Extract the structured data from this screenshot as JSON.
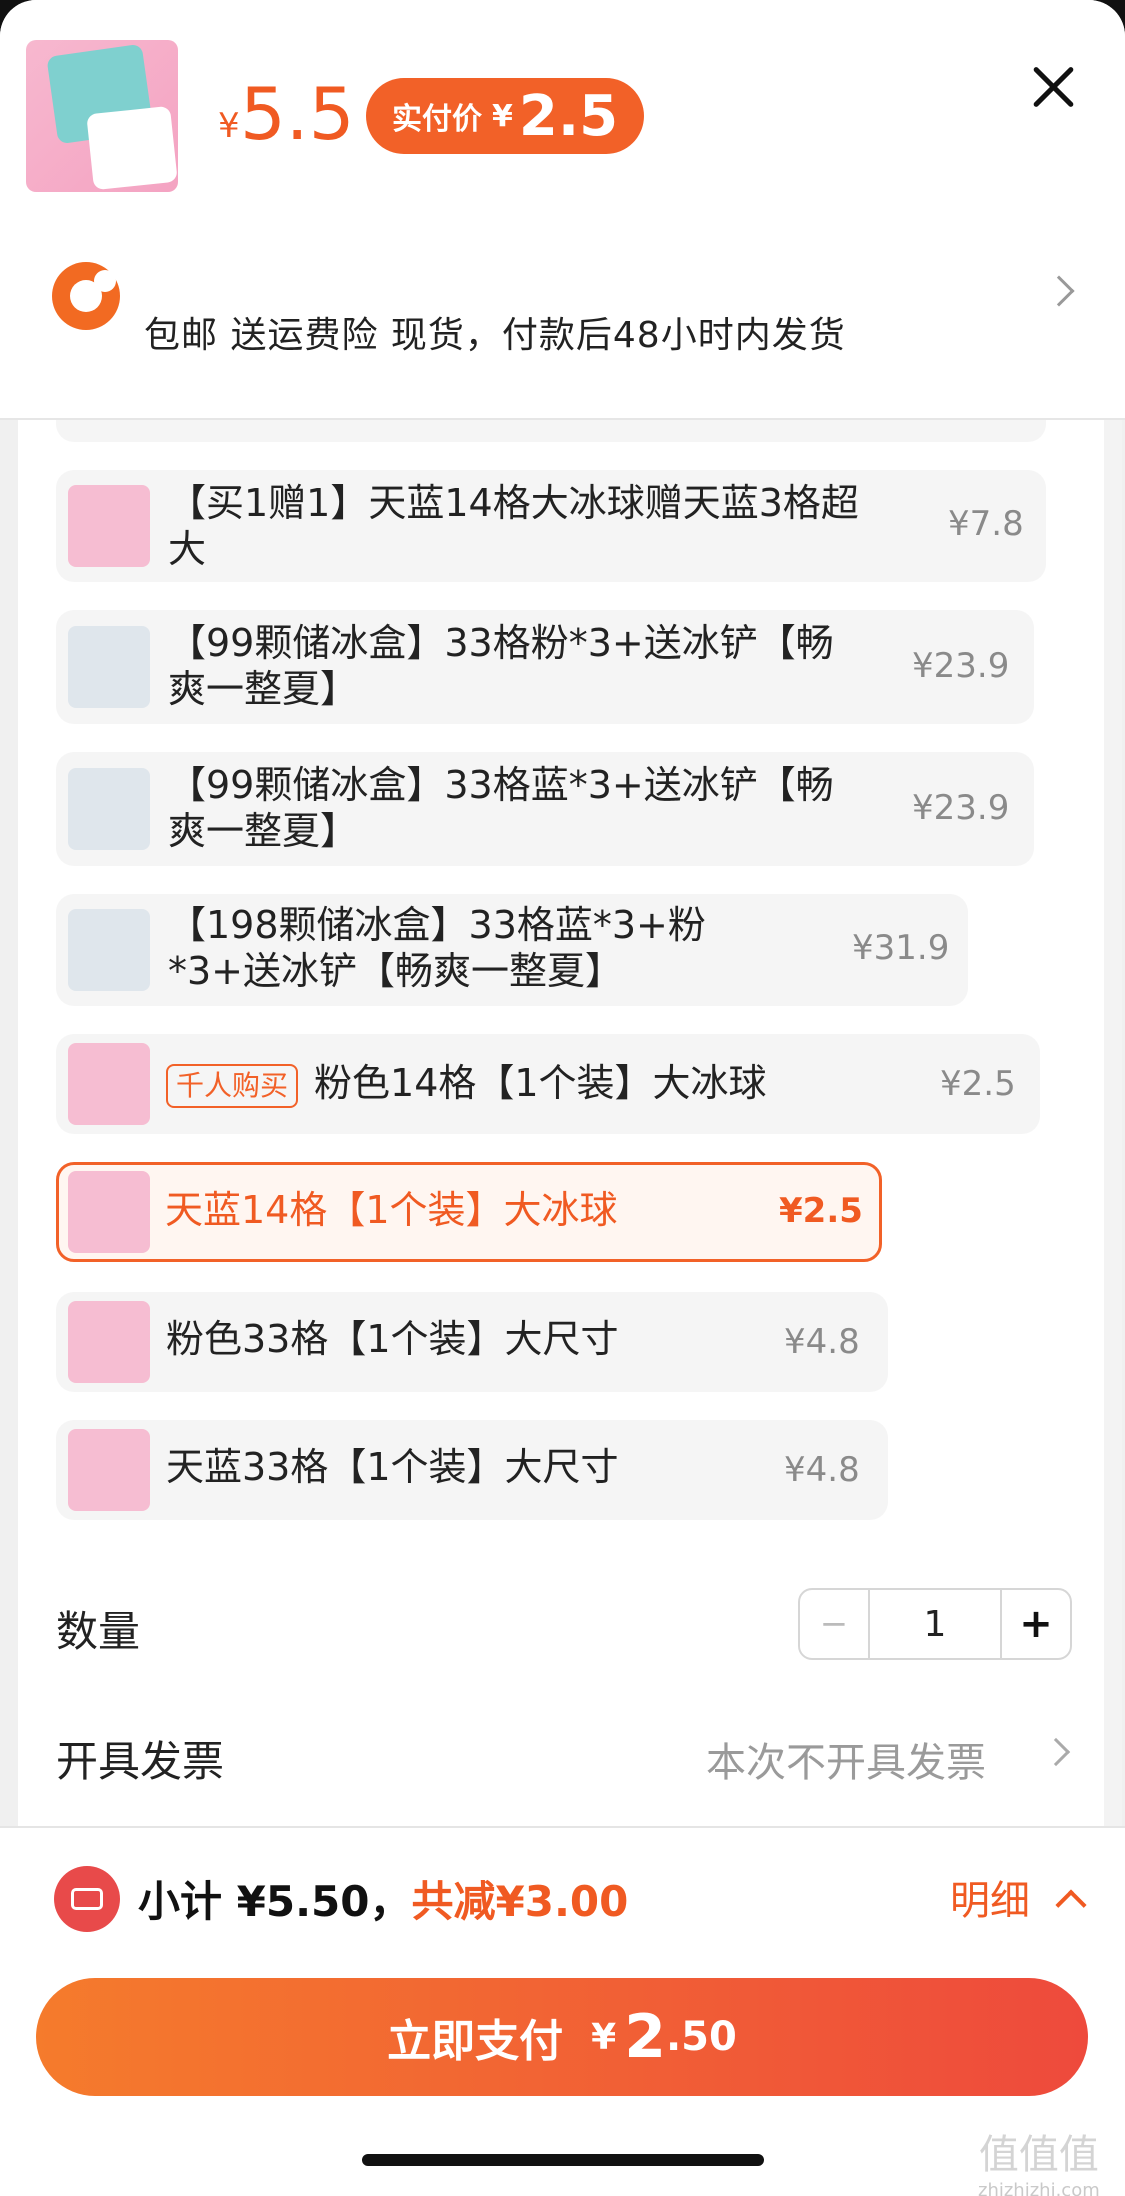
{
  "header": {
    "price_currency": "¥",
    "price": "5.5",
    "pay_label": "实付价",
    "pay_currency": "¥",
    "pay_amount": "2.5",
    "shipping": "包邮  送运费险  现货，付款后48小时内发货"
  },
  "options": [
    {
      "title": "【买1赠1】天蓝14格大冰球赠天蓝3格超大",
      "price": "¥7.8",
      "thumb_color": "#f6bdd2",
      "selected": false
    },
    {
      "title": "【99颗储冰盒】33格粉*3+送冰铲【畅爽一整夏】",
      "price": "¥23.9",
      "thumb_color": "#dfe6ec",
      "selected": false
    },
    {
      "title": "【99颗储冰盒】33格蓝*3+送冰铲【畅爽一整夏】",
      "price": "¥23.9",
      "thumb_color": "#dfe6ec",
      "selected": false
    },
    {
      "title": "【198颗储冰盒】33格蓝*3+粉*3+送冰铲【畅爽一整夏】",
      "price": "¥31.9",
      "thumb_color": "#dfe6ec",
      "selected": false
    },
    {
      "badge": "千人购买",
      "title": "粉色14格【1个装】大冰球",
      "price": "¥2.5",
      "thumb_color": "#f6bdd2",
      "selected": false
    },
    {
      "title": "天蓝14格【1个装】大冰球",
      "price": "¥2.5",
      "thumb_color": "#f6bdd2",
      "selected": true
    },
    {
      "title": "粉色33格【1个装】大尺寸",
      "price": "¥4.8",
      "thumb_color": "#f6bdd2",
      "selected": false
    },
    {
      "title": "天蓝33格【1个装】大尺寸",
      "price": "¥4.8",
      "thumb_color": "#f6bdd2",
      "selected": false
    }
  ],
  "quantity": {
    "label": "数量",
    "minus": "−",
    "value": "1",
    "plus": "+"
  },
  "invoice": {
    "label": "开具发票",
    "value": "本次不开具发票"
  },
  "footer": {
    "subtotal_label": "小计",
    "subtotal": "¥5.50，",
    "discount": "共减¥3.00",
    "detail": "明细",
    "pay_label": "立即支付",
    "pay_currency": "¥",
    "pay_int": "2",
    "pay_dec": ".50"
  },
  "watermark": {
    "chars": "值值值",
    "site": "zhizhizhi.com"
  }
}
